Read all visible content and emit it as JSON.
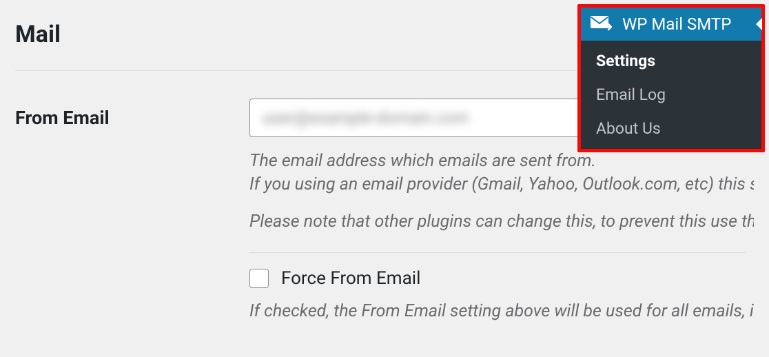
{
  "section": {
    "title": "Mail"
  },
  "fromEmail": {
    "label": "From Email",
    "value": "user@example-domain.com",
    "help1": "The email address which emails are sent from.",
    "help2": "If you using an email provider (Gmail, Yahoo, Outlook.com, etc) this s",
    "help3": "Please note that other plugins can change this, to prevent this use th"
  },
  "forceFromEmail": {
    "label": "Force From Email",
    "help": "If checked, the From Email setting above will be used for all emails, ig",
    "checked": false
  },
  "flyout": {
    "title": "WP Mail SMTP",
    "items": [
      {
        "label": "Settings",
        "active": true
      },
      {
        "label": "Email Log",
        "active": false
      },
      {
        "label": "About Us",
        "active": false
      }
    ]
  }
}
